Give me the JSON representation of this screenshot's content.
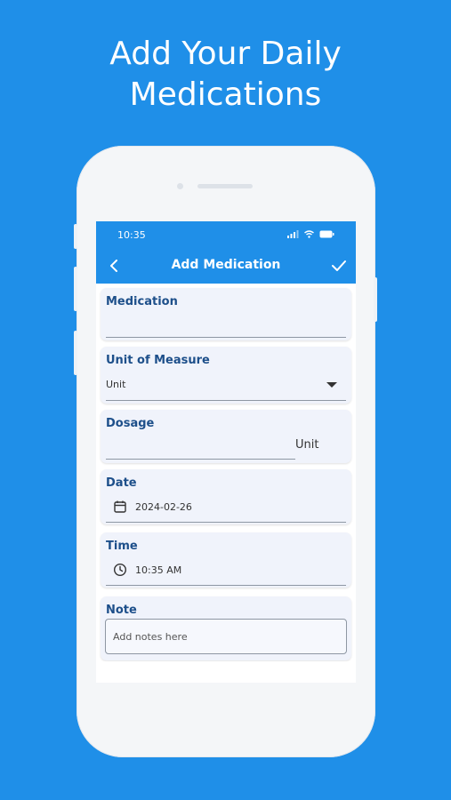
{
  "headline": {
    "line1": "Add Your Daily",
    "line2": "Medications"
  },
  "status_bar": {
    "time": "10:35"
  },
  "app_bar": {
    "title": "Add Medication",
    "back_icon": "chevron-left-icon",
    "save_icon": "check-icon"
  },
  "form": {
    "medication": {
      "label": "Medication",
      "value": ""
    },
    "unit_of_measure": {
      "label": "Unit of Measure",
      "value": "Unit"
    },
    "dosage": {
      "label": "Dosage",
      "value": "",
      "suffix": "Unit"
    },
    "date": {
      "label": "Date",
      "value": "2024-02-26",
      "icon": "calendar-icon"
    },
    "time": {
      "label": "Time",
      "value": "10:35 AM",
      "icon": "clock-icon"
    },
    "note": {
      "label": "Note",
      "placeholder": "Add notes here"
    }
  },
  "colors": {
    "background": "#1f8fe8",
    "app_bar": "#1f8fe8",
    "label": "#1d4f8a",
    "card": "#f0f3fb"
  }
}
